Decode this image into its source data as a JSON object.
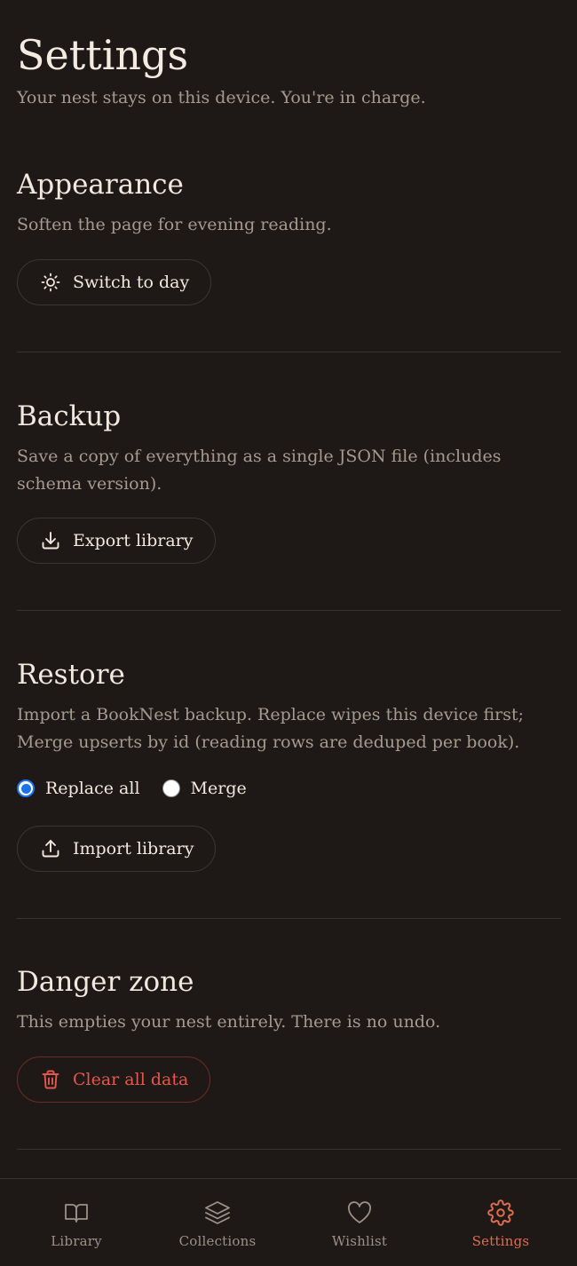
{
  "header": {
    "title": "Settings",
    "subtitle": "Your nest stays on this device. You're in charge."
  },
  "appearance": {
    "title": "Appearance",
    "description": "Soften the page for evening reading.",
    "button_label": "Switch to day",
    "icon": "sun-icon"
  },
  "backup": {
    "title": "Backup",
    "description": "Save a copy of everything as a single JSON file (includes schema version).",
    "button_label": "Export library",
    "icon": "download-icon"
  },
  "restore": {
    "title": "Restore",
    "description": "Import a BookNest backup. Replace wipes this device first; Merge upserts by id (reading rows are deduped per book).",
    "options": [
      {
        "label": "Replace all",
        "selected": true
      },
      {
        "label": "Merge",
        "selected": false
      }
    ],
    "button_label": "Import library",
    "icon": "upload-icon"
  },
  "danger": {
    "title": "Danger zone",
    "description": "This empties your nest entirely. There is no undo.",
    "button_label": "Clear all data",
    "icon": "trash-icon"
  },
  "nav": {
    "items": [
      {
        "label": "Library",
        "icon": "book-open-icon",
        "active": false
      },
      {
        "label": "Collections",
        "icon": "layers-icon",
        "active": false
      },
      {
        "label": "Wishlist",
        "icon": "heart-icon",
        "active": false
      },
      {
        "label": "Settings",
        "icon": "gear-icon",
        "active": true
      }
    ]
  },
  "colors": {
    "background": "#1e1916",
    "text": "#f1e9df",
    "muted": "#a59a90",
    "accent": "#e06d4f",
    "danger": "#e4574c",
    "radio": "#1a73e8"
  }
}
